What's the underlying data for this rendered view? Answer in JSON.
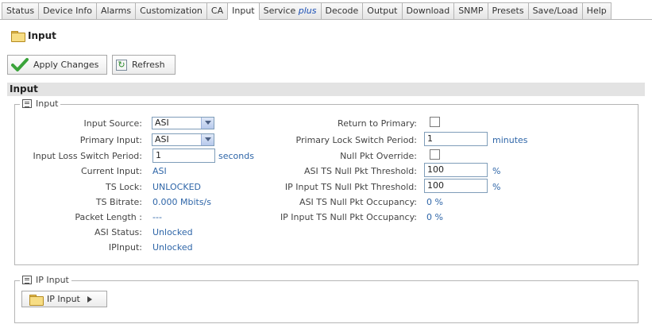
{
  "tabs": [
    {
      "label": "Status"
    },
    {
      "label": "Device Info"
    },
    {
      "label": "Alarms"
    },
    {
      "label": "Customization"
    },
    {
      "label": "CA"
    },
    {
      "label": "Input",
      "active": true
    },
    {
      "label": "Service",
      "em": "plus"
    },
    {
      "label": "Decode"
    },
    {
      "label": "Output"
    },
    {
      "label": "Download"
    },
    {
      "label": "SNMP"
    },
    {
      "label": "Presets"
    },
    {
      "label": "Save/Load"
    },
    {
      "label": "Help"
    }
  ],
  "page_title": "Input",
  "actions": {
    "apply": "Apply Changes",
    "refresh": "Refresh"
  },
  "section_title": "Input",
  "input_group": {
    "legend": "Input",
    "left": {
      "input_source": {
        "label": "Input Source:",
        "value": "ASI"
      },
      "primary_input": {
        "label": "Primary Input:",
        "value": "ASI"
      },
      "loss_switch": {
        "label": "Input Loss Switch Period:",
        "value": "1",
        "unit": "seconds"
      },
      "current_input": {
        "label": "Current Input:",
        "value": "ASI"
      },
      "ts_lock": {
        "label": "TS Lock:",
        "value": "UNLOCKED"
      },
      "ts_bitrate": {
        "label": "TS Bitrate:",
        "value": "0.000 Mbits/s"
      },
      "packet_length": {
        "label": "Packet Length :",
        "value": "---"
      },
      "asi_status": {
        "label": "ASI Status:",
        "value": "Unlocked"
      },
      "ip_input": {
        "label": "IPInput:",
        "value": "Unlocked"
      }
    },
    "right": {
      "return_primary": {
        "label": "Return to Primary:",
        "checked": false
      },
      "primary_lock": {
        "label": "Primary Lock Switch Period:",
        "value": "1",
        "unit": "minutes"
      },
      "null_override": {
        "label": "Null Pkt Override:",
        "checked": false
      },
      "asi_threshold": {
        "label": "ASI TS Null Pkt Threshold:",
        "value": "100",
        "unit": "%"
      },
      "ip_threshold": {
        "label": "IP Input TS Null Pkt Threshold:",
        "value": "100",
        "unit": "%"
      },
      "asi_occupancy": {
        "label": "ASI TS Null Pkt Occupancy:",
        "value": "0 %"
      },
      "ip_occupancy": {
        "label": "IP Input TS Null Pkt Occupancy:",
        "value": "0 %"
      }
    }
  },
  "ip_group": {
    "legend": "IP Input",
    "button": "IP Input"
  },
  "colors": {
    "value_blue": "#2f66a8",
    "apply_check": "#3aa33a"
  }
}
